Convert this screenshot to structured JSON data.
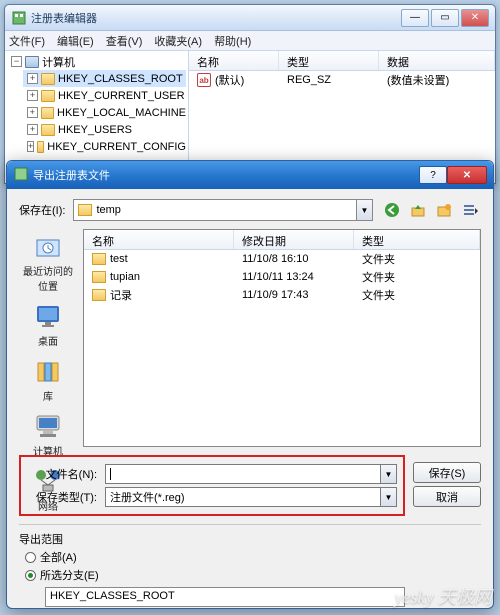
{
  "regedit": {
    "title": "注册表编辑器",
    "menu": {
      "file": "文件(F)",
      "edit": "编辑(E)",
      "view": "查看(V)",
      "fav": "收藏夹(A)",
      "help": "帮助(H)"
    },
    "tree": {
      "root": "计算机",
      "keys": [
        "HKEY_CLASSES_ROOT",
        "HKEY_CURRENT_USER",
        "HKEY_LOCAL_MACHINE",
        "HKEY_USERS",
        "HKEY_CURRENT_CONFIG"
      ]
    },
    "cols": {
      "name": "名称",
      "type": "类型",
      "data": "数据"
    },
    "row": {
      "name": "(默认)",
      "type": "REG_SZ",
      "data": "(数值未设置)"
    },
    "winbtns": {
      "min": "—",
      "max": "▭",
      "close": "✕"
    }
  },
  "dialog": {
    "title": "导出注册表文件",
    "savein_label": "保存在(I):",
    "savein_value": "temp",
    "cols": {
      "name": "名称",
      "date": "修改日期",
      "type": "类型"
    },
    "rows": [
      {
        "name": "test",
        "date": "11/10/8 16:10",
        "type": "文件夹"
      },
      {
        "name": "tupian",
        "date": "11/10/11 13:24",
        "type": "文件夹"
      },
      {
        "name": "记录",
        "date": "11/10/9 17:43",
        "type": "文件夹"
      }
    ],
    "places": [
      {
        "id": "recent",
        "label": "最近访问的位置"
      },
      {
        "id": "desktop",
        "label": "桌面"
      },
      {
        "id": "libraries",
        "label": "库"
      },
      {
        "id": "computer",
        "label": "计算机"
      },
      {
        "id": "network",
        "label": "网络"
      }
    ],
    "filename_label": "文件名(N):",
    "filename_value": "",
    "filetype_label": "保存类型(T):",
    "filetype_value": "注册文件(*.reg)",
    "save_btn": "保存(S)",
    "cancel_btn": "取消",
    "scope": {
      "title": "导出范围",
      "all": "全部(A)",
      "branch": "所选分支(E)",
      "branch_value": "HKEY_CLASSES_ROOT"
    }
  },
  "watermark": "yesky 天极网"
}
